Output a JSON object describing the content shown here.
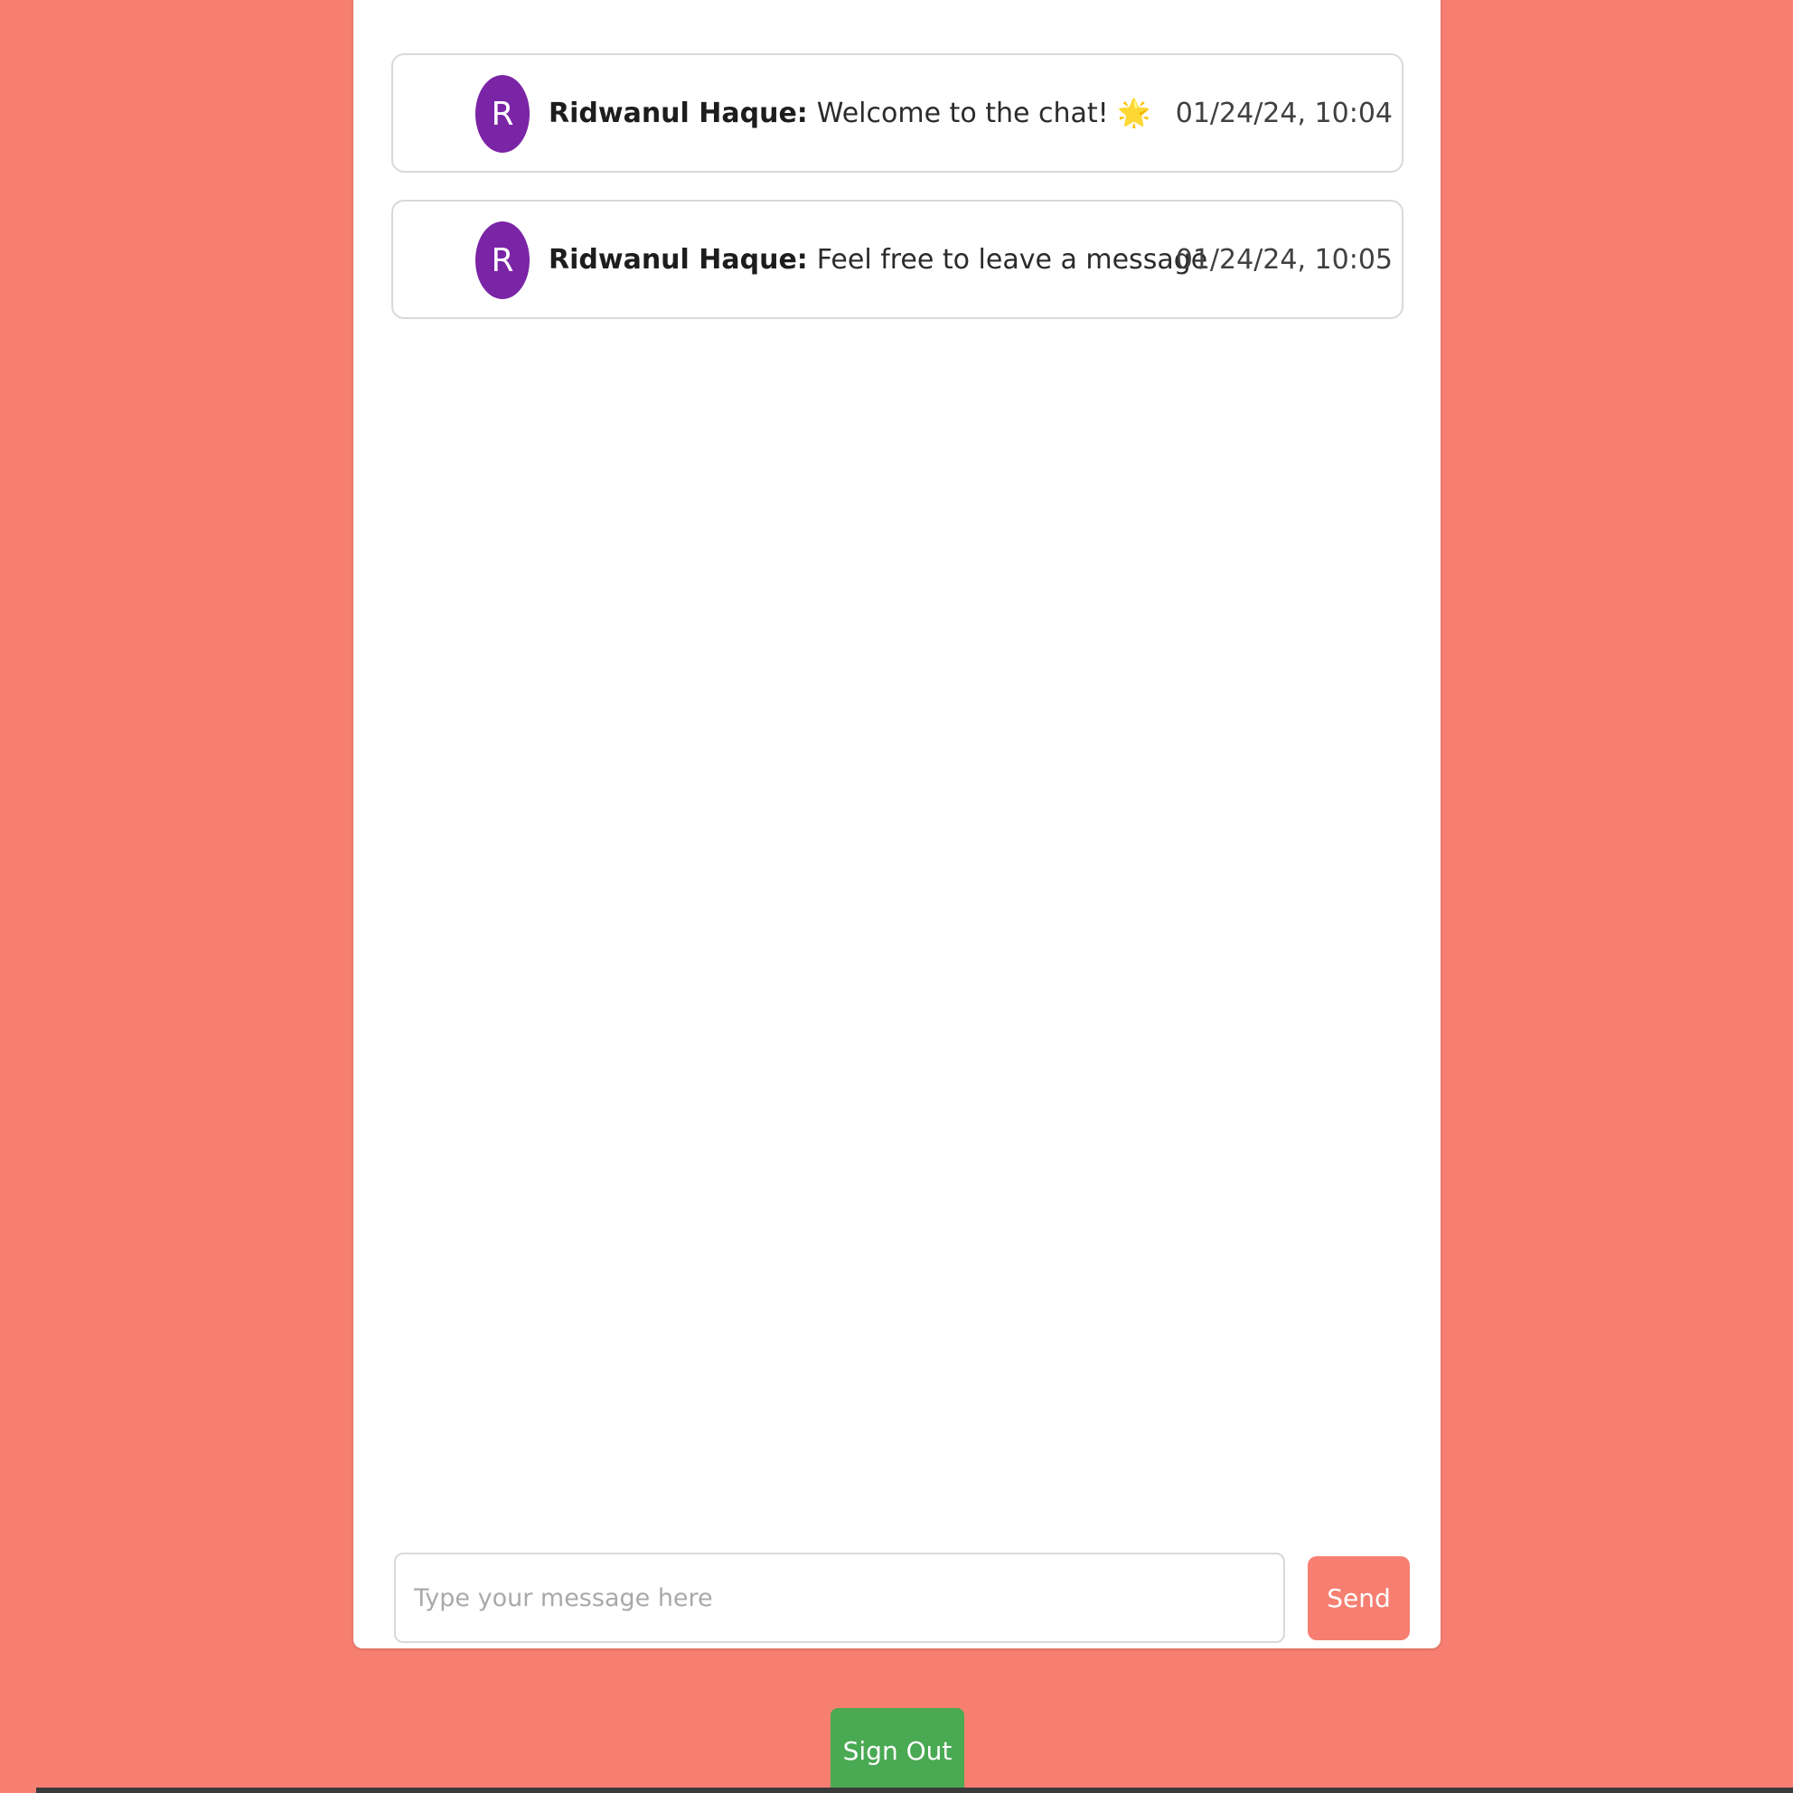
{
  "messages": [
    {
      "avatar_initial": "R",
      "author": "Ridwanul Haque:",
      "text": "Welcome to the chat! 🌟",
      "timestamp": "01/24/24, 10:04"
    },
    {
      "avatar_initial": "R",
      "author": "Ridwanul Haque:",
      "text": "Feel free to leave a message",
      "timestamp": "01/24/24, 10:05"
    }
  ],
  "composer": {
    "placeholder": "Type your message here",
    "value": "",
    "send_label": "Send"
  },
  "footer": {
    "sign_out_label": "Sign Out"
  },
  "colors": {
    "background": "#f67f71",
    "avatar": "#7a24a6",
    "send_button": "#f67f71",
    "sign_out_button": "#4aa953"
  }
}
